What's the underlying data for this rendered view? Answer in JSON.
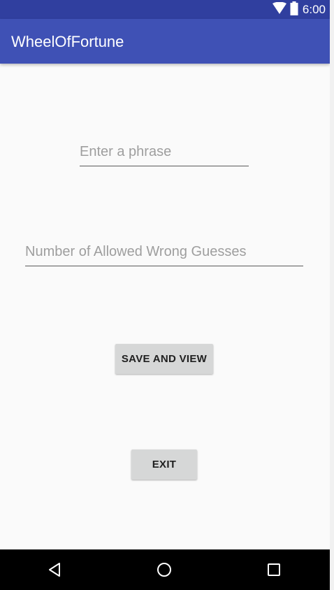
{
  "status_bar": {
    "time": "6:00",
    "icons": [
      "wifi-icon",
      "battery-icon"
    ],
    "background": "#303f9f"
  },
  "app_bar": {
    "title": "WheelOfFortune",
    "background": "#3f51b5"
  },
  "form": {
    "phrase_placeholder": "Enter a phrase",
    "phrase_value": "",
    "guesses_placeholder": "Number of Allowed Wrong Guesses",
    "guesses_value": ""
  },
  "buttons": {
    "save_label": "SAVE AND VIEW",
    "exit_label": "EXIT"
  },
  "nav_bar": {
    "icons": [
      "back-icon",
      "home-icon",
      "recent-apps-icon"
    ]
  }
}
